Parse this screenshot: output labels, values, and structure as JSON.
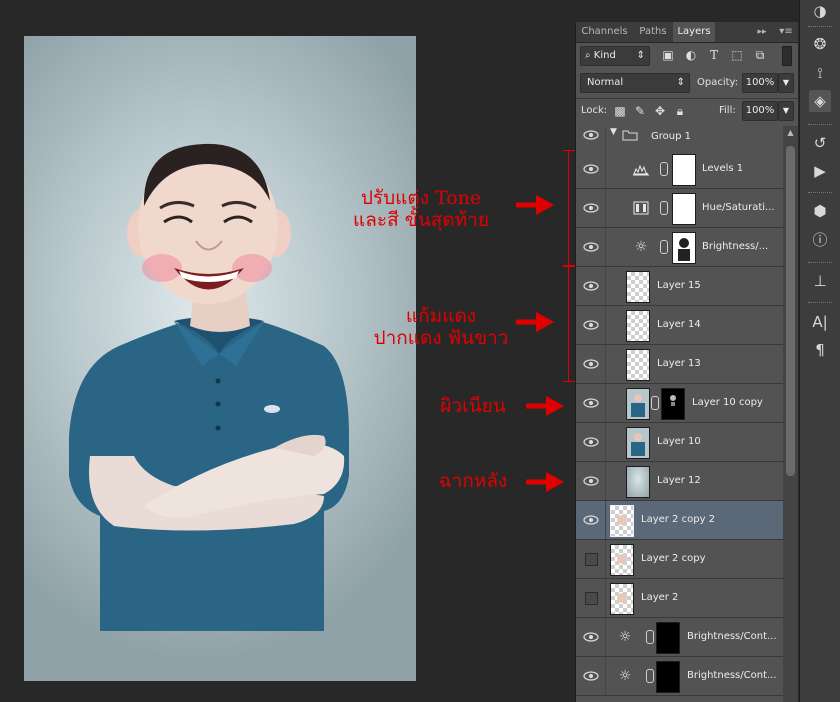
{
  "panel": {
    "tabs": [
      "Channels",
      "Paths",
      "Layers"
    ],
    "active_tab": "Layers",
    "filter_kind": "Kind",
    "blend_mode": "Normal",
    "opacity_label": "Opacity:",
    "opacity_value": "100%",
    "lock_label": "Lock:",
    "fill_label": "Fill:",
    "fill_value": "100%"
  },
  "layers": [
    {
      "name": "Group 1",
      "type": "group",
      "visible": true
    },
    {
      "name": "Levels 1",
      "type": "adjustment",
      "icon": "levels-icon",
      "visible": true
    },
    {
      "name": "Hue/Saturati...",
      "type": "adjustment",
      "icon": "hue-saturation-icon",
      "visible": true
    },
    {
      "name": "Brightness/...",
      "type": "adjustment",
      "icon": "brightness-icon",
      "visible": true
    },
    {
      "name": "Layer 15",
      "type": "pixel",
      "visible": true
    },
    {
      "name": "Layer 14",
      "type": "pixel",
      "visible": true
    },
    {
      "name": "Layer 13",
      "type": "pixel",
      "visible": true
    },
    {
      "name": "Layer 10 copy",
      "type": "pixel-masked",
      "visible": true
    },
    {
      "name": "Layer 10",
      "type": "pixel",
      "visible": true
    },
    {
      "name": "Layer 12",
      "type": "pixel",
      "visible": true
    },
    {
      "name": "Layer 2 copy 2",
      "type": "pixel",
      "visible": true,
      "selected": true
    },
    {
      "name": "Layer 2 copy",
      "type": "pixel",
      "visible": false
    },
    {
      "name": "Layer 2",
      "type": "pixel",
      "visible": false
    },
    {
      "name": "Brightness/Cont...",
      "type": "adjustment",
      "icon": "brightness-icon",
      "visible": true
    },
    {
      "name": "Brightness/Cont...",
      "type": "adjustment",
      "icon": "brightness-icon",
      "visible": true
    }
  ],
  "annotations": {
    "tone_line1": "ปรับแต่ง Tone",
    "tone_line2": "และสี ขั้นสุดท้าย",
    "cheek_line1": "แก้มแดง",
    "cheek_line2": "ปากแดง ฟันขาว",
    "skin": "ผิวเนียน",
    "background": "ฉากหลัง"
  },
  "colors": {
    "annotation_red": "#e10000",
    "selected_row": "#5b6878",
    "panel_bg": "#535353"
  }
}
